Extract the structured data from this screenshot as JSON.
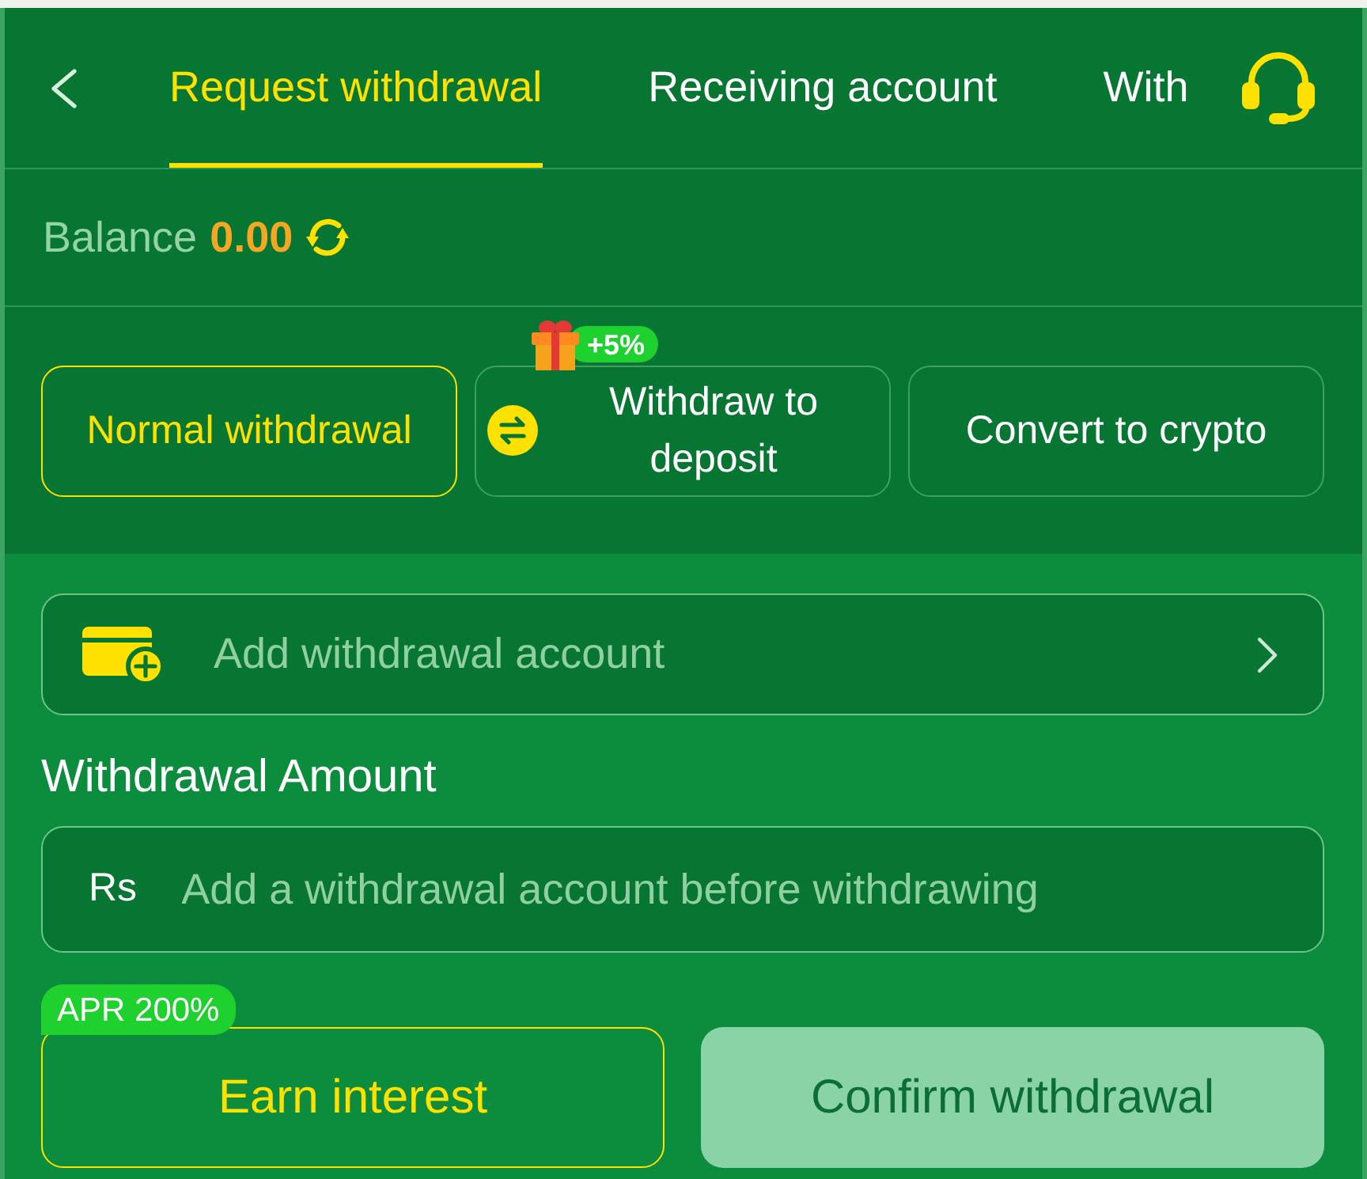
{
  "header": {
    "tabs": [
      {
        "label": "Request withdrawal",
        "selected": true
      },
      {
        "label": "Receiving account",
        "selected": false
      },
      {
        "label": "With",
        "selected": false
      }
    ]
  },
  "balance": {
    "label": "Balance",
    "amount": "0.00"
  },
  "methods": [
    {
      "kind": "plain",
      "label": "Normal withdrawal",
      "selected": true
    },
    {
      "kind": "bonus",
      "label": "Withdraw to deposit",
      "badge": "+5%",
      "selected": false
    },
    {
      "kind": "plain",
      "label": "Convert to crypto",
      "selected": false
    }
  ],
  "account_row": {
    "label": "Add withdrawal account"
  },
  "amount": {
    "label": "Withdrawal Amount",
    "currency": "Rs",
    "placeholder": "Add a withdrawal account before withdrawing"
  },
  "earn_button": {
    "label": "Earn interest",
    "badge": "APR 200%"
  },
  "confirm_button": {
    "label": "Confirm withdrawal",
    "disabled": true
  }
}
